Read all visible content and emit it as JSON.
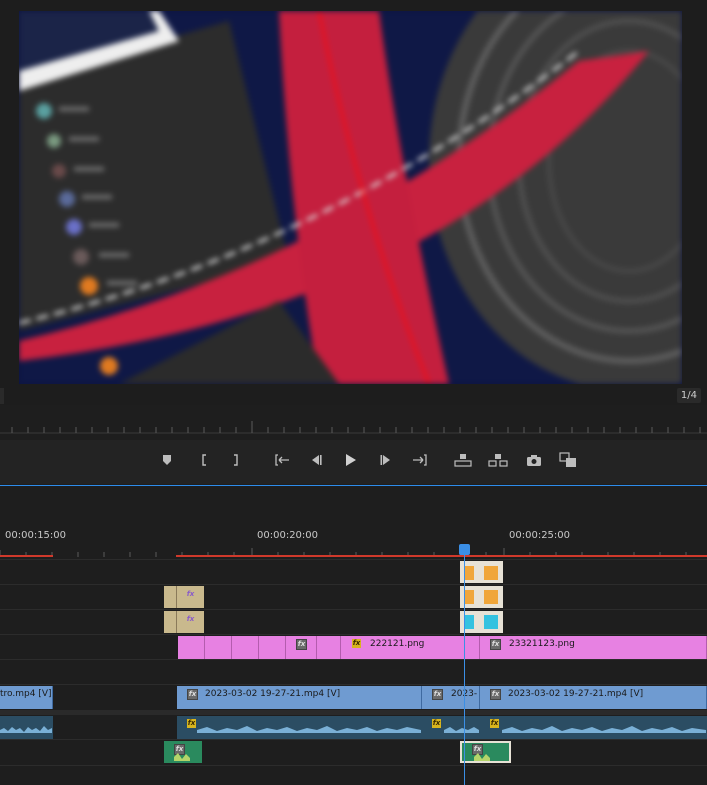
{
  "monitor": {
    "page_indicator": "1/4",
    "preview_description_icon": "blurred-video-frame"
  },
  "transport": {
    "buttons": [
      {
        "name": "add-marker-button",
        "icon": "marker-icon"
      },
      {
        "name": "mark-in-button",
        "icon": "mark-in-icon"
      },
      {
        "name": "mark-out-button",
        "icon": "mark-out-icon"
      },
      {
        "name": "go-to-in-button",
        "icon": "go-to-in-icon"
      },
      {
        "name": "step-back-button",
        "icon": "step-back-icon"
      },
      {
        "name": "play-button",
        "icon": "play-icon"
      },
      {
        "name": "step-forward-button",
        "icon": "step-forward-icon"
      },
      {
        "name": "go-to-out-button",
        "icon": "go-to-out-icon"
      },
      {
        "name": "lift-button",
        "icon": "lift-icon"
      },
      {
        "name": "extract-button",
        "icon": "extract-icon"
      },
      {
        "name": "export-frame-button",
        "icon": "camera-icon"
      },
      {
        "name": "comparison-view-button",
        "icon": "comparison-icon"
      }
    ]
  },
  "timeline": {
    "timecodes": [
      "00:00:15:00",
      "00:00:20:00",
      "00:00:25:00"
    ],
    "clips": {
      "image1": "222121.png",
      "image2": "23321123.png",
      "video_left": "tro.mp4 [V]",
      "video_main": "2023-03-02 19-27-21.mp4 [V]",
      "video_short": "2023-",
      "video_right": "2023-03-02 19-27-21.mp4 [V]"
    },
    "fx_label": "fx",
    "colors": {
      "image_clip": "#e781e2",
      "video_clip": "#6f9bd1",
      "audio_clip": "#2b4d63",
      "playhead": "#3b8fe6",
      "work_area": "#d0392b"
    }
  }
}
